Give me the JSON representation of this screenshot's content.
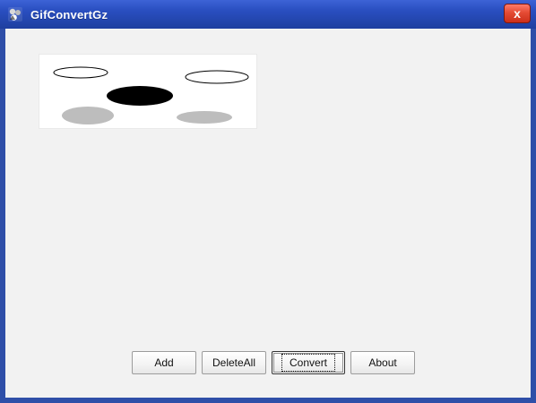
{
  "window": {
    "title": "GifConvertGz",
    "close_label": "x"
  },
  "preview": {
    "icon": "gif-preview"
  },
  "buttons": {
    "add": "Add",
    "delete_all": "DeleteAll",
    "convert": "Convert",
    "about": "About"
  },
  "colors": {
    "titlebar_blue": "#2a4fc1",
    "window_bg": "#f2f2f2",
    "preview_bg": "#ffffff",
    "ellipse_gray": "#bdbdbd",
    "ellipse_black": "#000000"
  }
}
